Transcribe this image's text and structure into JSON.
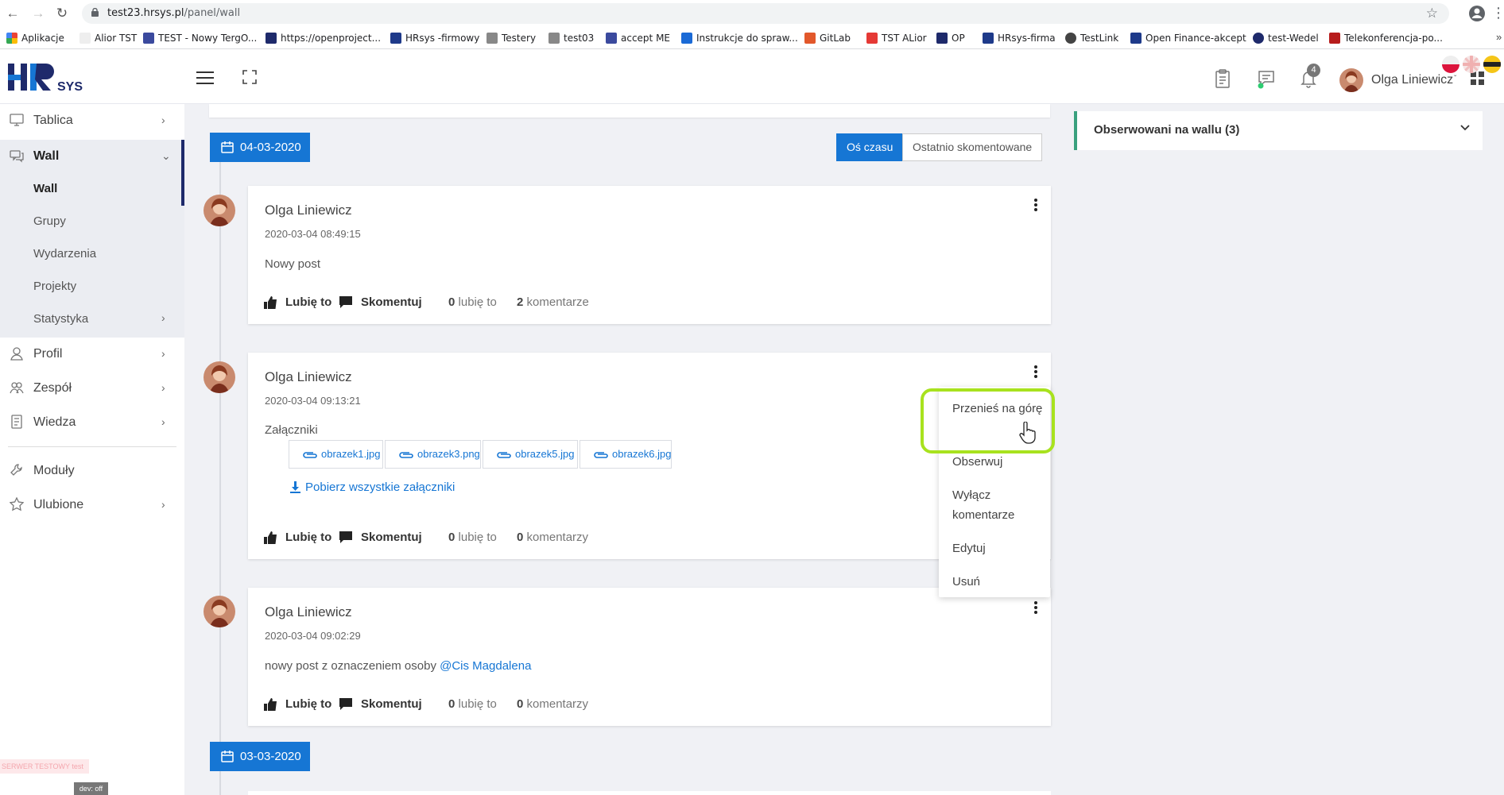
{
  "browser": {
    "url_host": "test23.hrsys.pl",
    "url_path": "/panel/wall",
    "bookmarks": [
      "Aplikacje",
      "Alior TST",
      "TEST - Nowy TergO...",
      "https://openproject...",
      "HRsys -firmowy",
      "Testery",
      "test03",
      "accept ME",
      "Instrukcje do spraw...",
      "GitLab",
      "TST ALior",
      "OP",
      "HRsys-firma",
      "TestLink",
      "Open Finance-akcept",
      "test-Wedel",
      "Telekonferencja-po..."
    ],
    "overflow": "»"
  },
  "header": {
    "logo_text": "HR",
    "logo_sub": "SYS",
    "notifications_count": "4",
    "user_name": "Olga Liniewicz",
    "caret": "ˇ"
  },
  "sidebar": {
    "items": [
      {
        "label": "Tablica",
        "icon": "monitor-icon"
      },
      {
        "label": "Wall",
        "icon": "chat-icon"
      },
      {
        "label": "Profil",
        "icon": "user-icon"
      },
      {
        "label": "Zespół",
        "icon": "team-icon"
      },
      {
        "label": "Wiedza",
        "icon": "book-icon"
      },
      {
        "label": "Moduły",
        "icon": "wrench-icon"
      },
      {
        "label": "Ulubione",
        "icon": "star-icon"
      }
    ],
    "wall_sub": [
      "Wall",
      "Grupy",
      "Wydarzenia",
      "Projekty",
      "Statystyka"
    ],
    "server_tag": "SERWER TESTOWY test",
    "dev_tag": "dev: off"
  },
  "wall": {
    "date1": "04-03-2020",
    "date2": "03-03-2020",
    "view_toggle": [
      "Oś czasu",
      "Ostatnio skomentowane"
    ],
    "like_label": "Lubię to",
    "comment_label": "Skomentuj",
    "likes_suffix": "lubię to",
    "posts": [
      {
        "author": "Olga Liniewicz",
        "date": "2020-03-04 08:49:15",
        "body": "Nowy post",
        "likes": "0",
        "comments": "2",
        "comments_suffix": "komentarze"
      },
      {
        "author": "Olga Liniewicz",
        "date": "2020-03-04 09:13:21",
        "attachments_label": "Załączniki",
        "attachments": [
          "obrazek1.jpg",
          "obrazek3.png",
          "obrazek5.jpg",
          "obrazek6.jpg"
        ],
        "download_all": "Pobierz wszystkie załączniki",
        "likes": "0",
        "comments": "0",
        "comments_suffix": "komentarzy"
      },
      {
        "author": "Olga Liniewicz",
        "date": "2020-03-04 09:02:29",
        "body": "nowy post z oznaczeniem osoby ",
        "mention": "@Cis Magdalena",
        "likes": "0",
        "comments": "0",
        "comments_suffix": "komentarzy"
      }
    ]
  },
  "observed": {
    "title": "Obserwowani na wallu (3)"
  },
  "menu": {
    "items": [
      "Przenieś na górę",
      "Obserwuj",
      "Wyłącz komentarze",
      "Edytuj",
      "Usuń"
    ]
  },
  "colors": {
    "accent": "#1676d4",
    "nav_dark": "#1e2a6b",
    "observed_border": "#3aa17e",
    "highlight": "#a8e21e"
  }
}
